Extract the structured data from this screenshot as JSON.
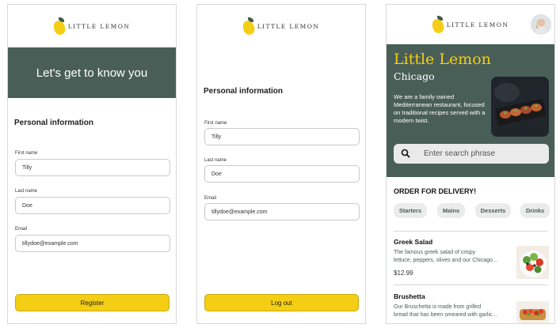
{
  "brand": {
    "logo_text": "LITTLE LEMON",
    "primary_color": "#495e57",
    "accent_color": "#f4ce14"
  },
  "onboarding": {
    "banner": "Let's get to know you",
    "section_title": "Personal information",
    "fields": [
      {
        "label": "First name",
        "value": "Tilly"
      },
      {
        "label": "Last name",
        "value": "Doe"
      },
      {
        "label": "Email",
        "value": "tillydoe@example.com"
      }
    ],
    "button": "Register"
  },
  "profile": {
    "section_title": "Personal information",
    "fields": [
      {
        "label": "First name",
        "value": "Tilly"
      },
      {
        "label": "Last name",
        "value": "Doe"
      },
      {
        "label": "Email",
        "value": "tillydoe@example.com"
      }
    ],
    "button": "Log out"
  },
  "home": {
    "hero_title": "Little Lemon",
    "hero_city": "Chicago",
    "hero_desc": "We are a family owned Mediterranean restaurant, focused on traditional recipes served with a modern twist.",
    "search_placeholder": "Enter search phrase",
    "order_title": "ORDER FOR DELIVERY!",
    "categories": [
      "Starters",
      "Mains",
      "Desserts",
      "Drinks"
    ],
    "menu": [
      {
        "name": "Greek Salad",
        "desc_line1": "The famous greek salad of crispy",
        "desc_line2": "lettuce, peppers, olives and our Chicago...",
        "price": "$12.99"
      },
      {
        "name": "Brushetta",
        "desc_line1": "Our Bruschetta is made from grilled",
        "desc_line2": "bread that has been smeared with garlic..."
      }
    ]
  }
}
